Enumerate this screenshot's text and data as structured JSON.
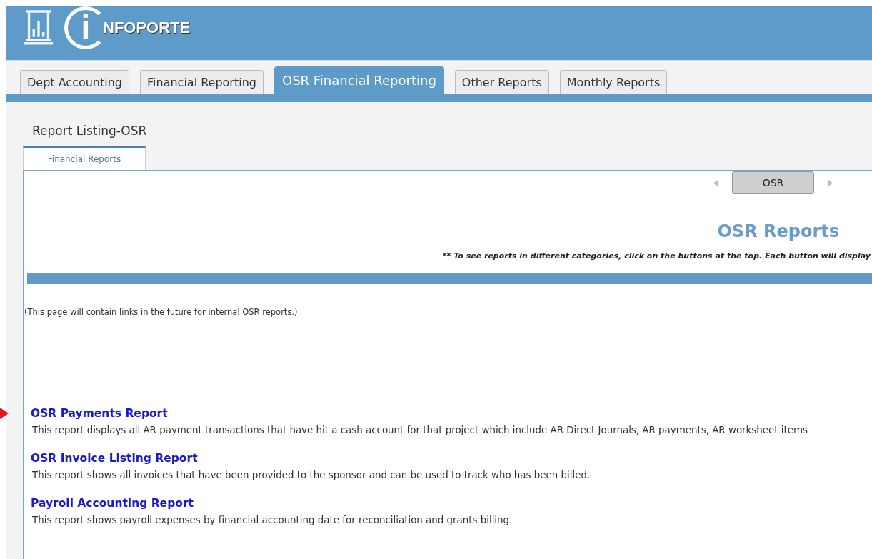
{
  "logo": {
    "initial": "i",
    "name": "NFOPORTE"
  },
  "tabs": [
    {
      "label": "Dept Accounting",
      "selected": false
    },
    {
      "label": "Financial Reporting",
      "selected": false
    },
    {
      "label": "OSR Financial Reporting",
      "selected": true
    },
    {
      "label": "Other Reports",
      "selected": false
    },
    {
      "label": "Monthly Reports",
      "selected": false
    }
  ],
  "page_title": "Report Listing-OSR",
  "subtabs": [
    {
      "label": "Financial Reports",
      "selected": true
    }
  ],
  "category_button": "OSR",
  "heading": "OSR Reports",
  "instruction": "** To see reports in different categories, click on the buttons at the top.  Each button will display",
  "note": "(This page will contain links in the future for internal OSR reports.)",
  "reports": [
    {
      "title": "OSR Payments Report",
      "description": "This report displays all AR payment transactions that have hit a cash account for that project which include AR Direct Journals, AR payments, AR worksheet items",
      "pointer": true
    },
    {
      "title": "OSR Invoice Listing Report",
      "description": "This report shows all invoices that have been provided to the sponsor and can be used to track who has been billed.",
      "pointer": false
    },
    {
      "title": "Payroll Accounting Report",
      "description": "This report shows payroll expenses by financial accounting date for reconciliation and grants billing.",
      "pointer": false
    }
  ]
}
